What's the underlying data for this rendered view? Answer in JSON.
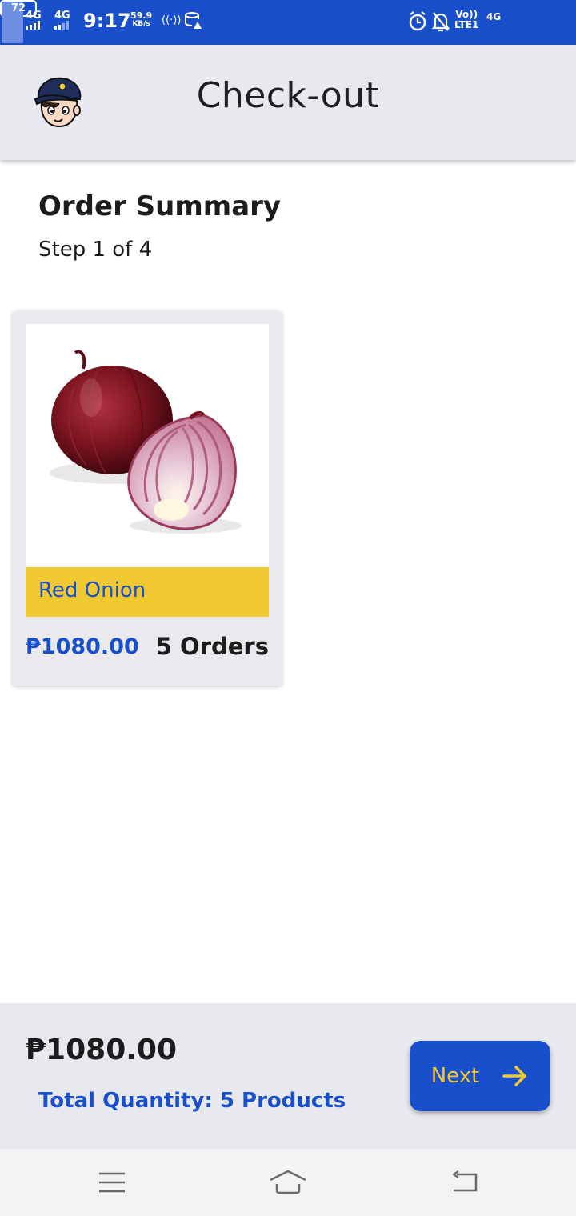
{
  "status_bar": {
    "network1": "4G",
    "network2": "4G",
    "time": "9:17",
    "speed_value": "59.9",
    "speed_unit": "KB/s",
    "volte_top": "Vo))",
    "volte_bottom": "LTE1",
    "network3": "4G",
    "battery": "72",
    "battery_level": 0.72,
    "icons": [
      "signal-bars-icon",
      "hotspot-icon",
      "data-saver-icon",
      "alarm-icon",
      "bell-off-icon",
      "battery-icon"
    ]
  },
  "header": {
    "title": "Check-out",
    "avatar_icon": "cartoon-avatar-icon"
  },
  "summary": {
    "title": "Order Summary",
    "step": "Step 1 of 4"
  },
  "product": {
    "name": "Red Onion",
    "price": "₱1080.00",
    "orders": "5 Orders",
    "image": "red-onion-image"
  },
  "footer": {
    "total_price": "₱1080.00",
    "total_quantity": "Total Quantity: 5 Products",
    "next_label": "Next",
    "next_icon": "arrow-right-icon"
  },
  "nav": {
    "icons": [
      "menu-icon",
      "home-icon",
      "back-icon"
    ]
  },
  "colors": {
    "primary_blue": "#1a4fcb",
    "accent_yellow": "#f0c930",
    "surface_gray": "#e8e9ee"
  }
}
